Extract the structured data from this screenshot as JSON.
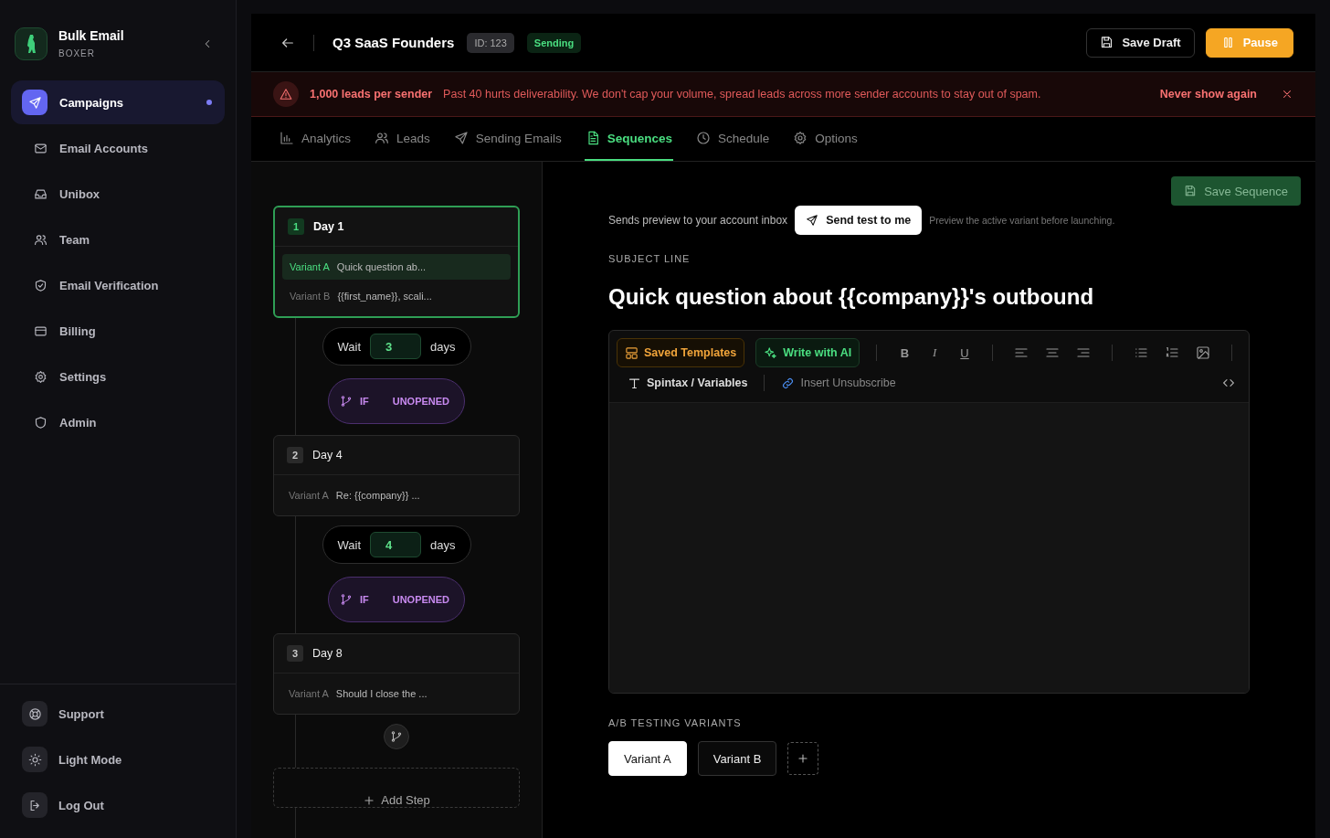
{
  "sidebar": {
    "brand": {
      "title": "Bulk Email",
      "subtitle": "BOXER"
    },
    "nav": [
      {
        "label": "Campaigns",
        "selected": true
      },
      {
        "label": "Email Accounts",
        "selected": false
      },
      {
        "label": "Unibox",
        "selected": false
      },
      {
        "label": "Team",
        "selected": false
      },
      {
        "label": "Email Verification",
        "selected": false
      },
      {
        "label": "Billing",
        "selected": false
      },
      {
        "label": "Settings",
        "selected": false
      },
      {
        "label": "Admin",
        "selected": false
      }
    ],
    "footer_items": [
      {
        "label": "Support"
      },
      {
        "label": "Light Mode"
      },
      {
        "label": "Log Out"
      }
    ]
  },
  "header": {
    "title": "Q3 SaaS Founders",
    "id_badge": "ID: 123",
    "status": "Sending",
    "buttons": [
      {
        "label": "Save Draft",
        "kind": "secondary"
      },
      {
        "label": "Pause",
        "kind": "primary"
      }
    ]
  },
  "banner": {
    "headline": "1,000 leads per sender",
    "message": "Past 40 hurts deliverability. We don't cap your volume, spread leads across more sender accounts to stay out of spam.",
    "action": "Never show again"
  },
  "tabs": [
    {
      "label": "Analytics",
      "selected": false
    },
    {
      "label": "Leads",
      "selected": false
    },
    {
      "label": "Sending Emails",
      "selected": false
    },
    {
      "label": "Sequences",
      "selected": true
    },
    {
      "label": "Schedule",
      "selected": false
    },
    {
      "label": "Options",
      "selected": false
    }
  ],
  "sequence": {
    "steps": [
      {
        "number": "1",
        "day": "Day 1",
        "selected": true,
        "variants": [
          {
            "label": "Variant A",
            "text": "Quick question ab...",
            "selected": true
          },
          {
            "label": "Variant B",
            "text": "{{first_name}}, scali...",
            "selected": false
          }
        ],
        "wait": {
          "label": "Wait",
          "value": "3",
          "unit": "days"
        },
        "condition": {
          "keyword": "IF",
          "event": "UNOPENED"
        }
      },
      {
        "number": "2",
        "day": "Day 4",
        "selected": false,
        "variants": [
          {
            "label": "Variant A",
            "text": "Re: {{company}} ...",
            "selected": false
          }
        ],
        "wait": {
          "label": "Wait",
          "value": "4",
          "unit": "days"
        },
        "condition": {
          "keyword": "IF",
          "event": "UNOPENED"
        }
      },
      {
        "number": "3",
        "day": "Day 8",
        "selected": false,
        "variants": [
          {
            "label": "Variant A",
            "text": "Should I close the ...",
            "selected": false
          }
        ]
      }
    ],
    "add_step": "Add Step"
  },
  "editor": {
    "save_button": "Save Sequence",
    "preview_note": "Sends preview to your account inbox",
    "test_button": "Send test to me",
    "hint": "Preview the active variant before launching.",
    "subject_label": "SUBJECT LINE",
    "subject": "Quick question about {{company}}'s outbound",
    "toolbar": {
      "templates": "Saved Templates",
      "ai": "Write with AI",
      "format": [
        "B",
        "I",
        "U"
      ],
      "spintax": "Spintax / Variables",
      "unsubscribe": "Insert Unsubscribe"
    },
    "variants_label": "A/B TESTING VARIANTS",
    "variants": [
      {
        "label": "Variant A",
        "selected": true
      },
      {
        "label": "Variant B",
        "selected": false
      }
    ]
  }
}
